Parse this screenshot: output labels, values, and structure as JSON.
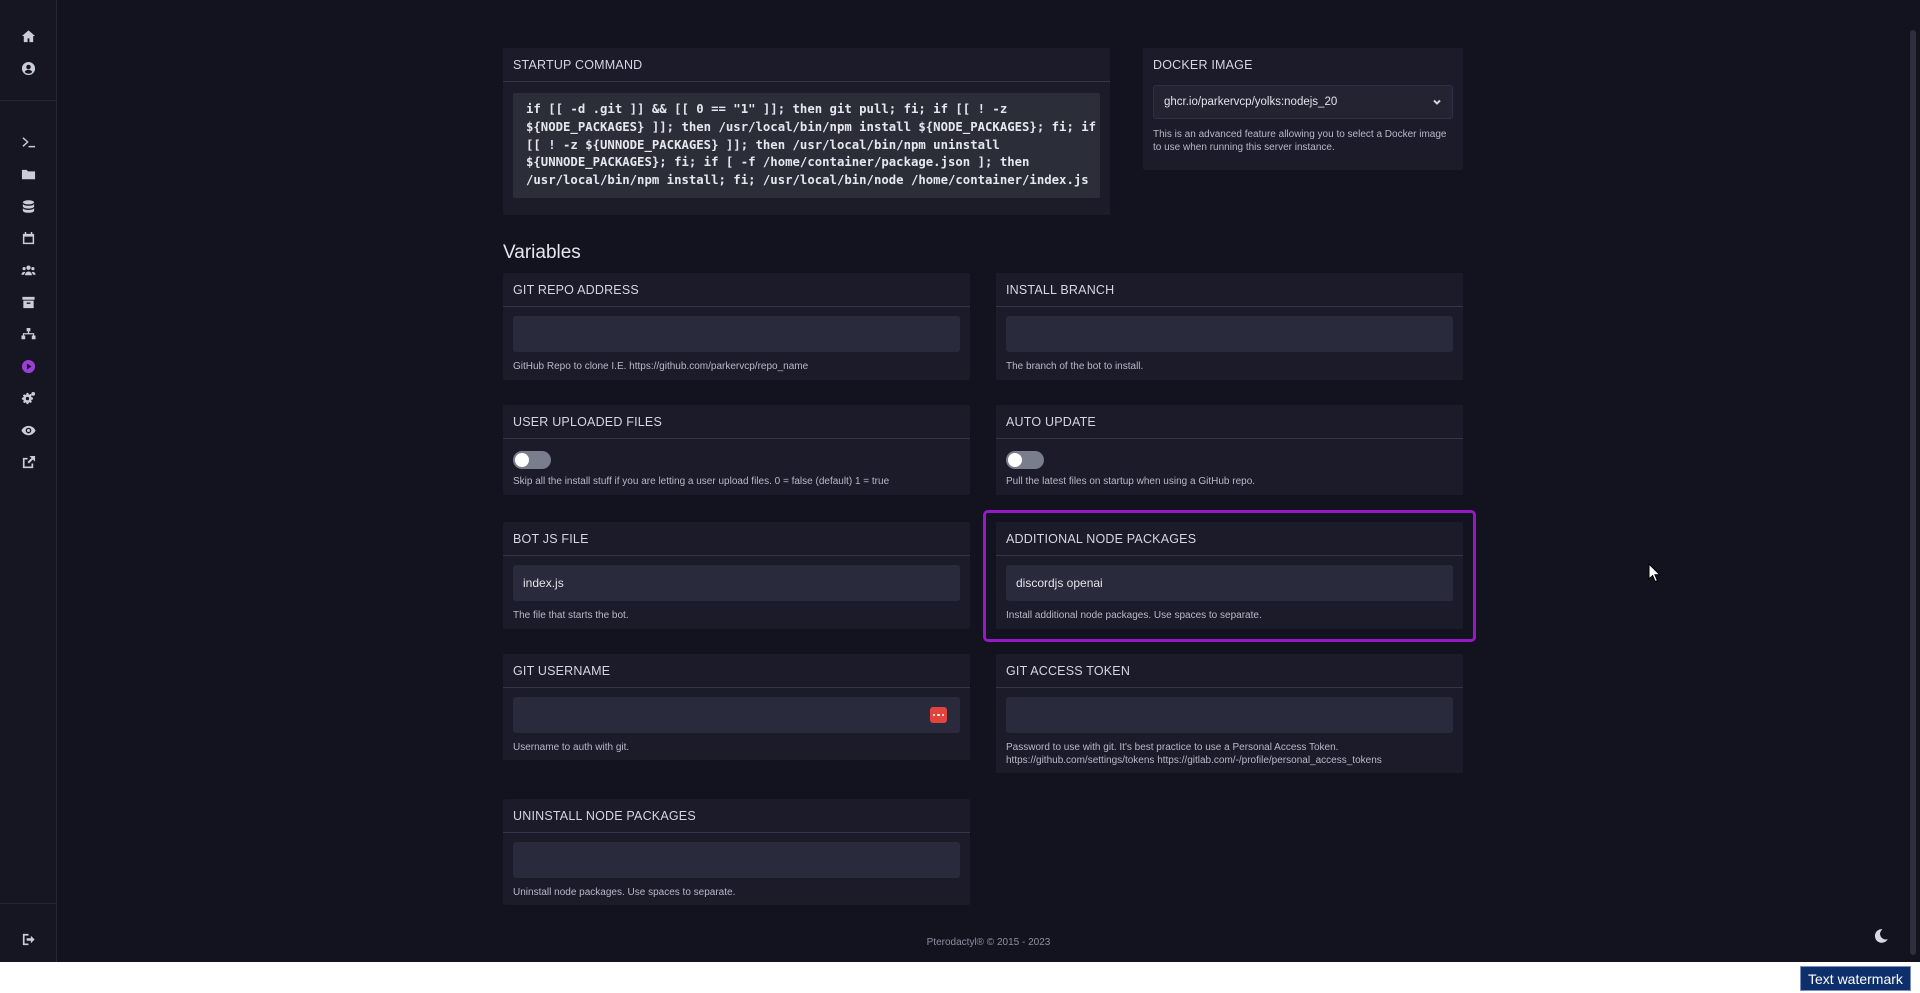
{
  "startup": {
    "title": "STARTUP COMMAND",
    "command_lines": [
      "if [[ -d .git ]] && [[ 0 == \"1\" ]]; then git pull; fi; if [[ ! -z",
      "${NODE_PACKAGES} ]]; then /usr/local/bin/npm install ${NODE_PACKAGES}; fi; if",
      "[[ ! -z ${UNNODE_PACKAGES} ]]; then /usr/local/bin/npm uninstall",
      "${UNNODE_PACKAGES}; fi; if [ -f /home/container/package.json ]; then",
      "/usr/local/bin/npm install; fi; /usr/local/bin/node /home/container/index.js"
    ]
  },
  "docker": {
    "title": "DOCKER IMAGE",
    "selected": "ghcr.io/parkervcp/yolks:nodejs_20",
    "hint": "This is an advanced feature allowing you to select a Docker image to use when running this server instance."
  },
  "variables_heading": "Variables",
  "variables": {
    "git_repo": {
      "title": "GIT REPO ADDRESS",
      "value": "",
      "hint": "GitHub Repo to clone I.E. https://github.com/parkervcp/repo_name"
    },
    "install_branch": {
      "title": "INSTALL BRANCH",
      "value": "",
      "hint": "The branch of the bot to install."
    },
    "user_uploaded": {
      "title": "USER UPLOADED FILES",
      "hint": "Skip all the install stuff if you are letting a user upload files. 0 = false (default) 1 = true"
    },
    "auto_update": {
      "title": "AUTO UPDATE",
      "hint": "Pull the latest files on startup when using a GitHub repo."
    },
    "bot_js": {
      "title": "BOT JS FILE",
      "value": "index.js",
      "hint": "The file that starts the bot."
    },
    "additional_packages": {
      "title": "ADDITIONAL NODE PACKAGES",
      "value": "discordjs openai",
      "hint": "Install additional node packages. Use spaces to separate."
    },
    "git_username": {
      "title": "GIT USERNAME",
      "value": "",
      "hint": "Username to auth with git."
    },
    "git_token": {
      "title": "GIT ACCESS TOKEN",
      "value": "",
      "hint": "Password to use with git. It's best practice to use a Personal Access Token.",
      "hint2": "https://github.com/settings/tokens https://gitlab.com/-/profile/personal_access_tokens"
    },
    "uninstall_packages": {
      "title": "UNINSTALL NODE PACKAGES",
      "value": "",
      "hint": "Uninstall node packages. Use spaces to separate."
    }
  },
  "footer": "Pterodactyl® © 2015 - 2023",
  "watermark": "Text watermark",
  "colors": {
    "accent": "#9a16c9",
    "background": "#131320",
    "card": "#1b1b2a"
  }
}
